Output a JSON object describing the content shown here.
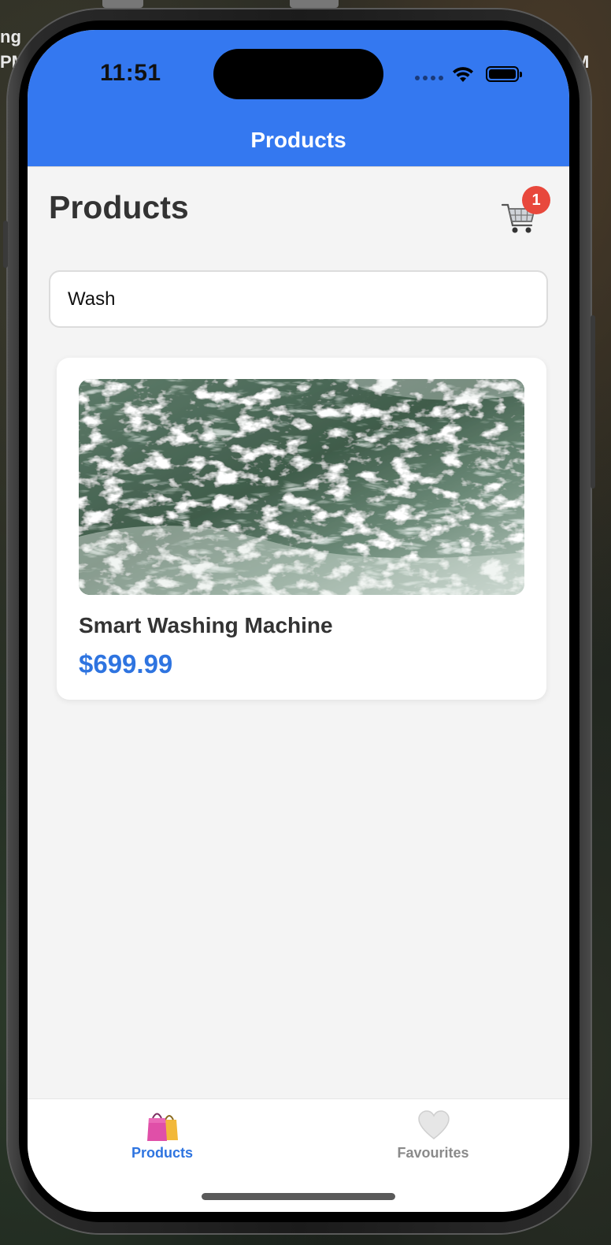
{
  "background": {
    "left_text_line1": "ng",
    "left_text_line2": "PM",
    "right_text": "M"
  },
  "status_bar": {
    "time": "11:51",
    "icons": [
      "cellular-dots-icon",
      "wifi-icon",
      "battery-icon"
    ]
  },
  "nav_bar": {
    "title": "Products",
    "background_color": "#3478f0"
  },
  "page": {
    "title": "Products",
    "cart": {
      "icon": "shopping-cart-icon",
      "badge_count": "1",
      "badge_color": "#e8483c"
    },
    "search": {
      "value": "Wash"
    }
  },
  "products": [
    {
      "name": "Smart Washing Machine",
      "price": "$699.99",
      "image": "ocean-waves-photo"
    }
  ],
  "tab_bar": {
    "tabs": [
      {
        "label": "Products",
        "icon": "shopping-bags-icon",
        "active": true
      },
      {
        "label": "Favourites",
        "icon": "heart-icon",
        "active": false
      }
    ],
    "active_color": "#2e74e0",
    "inactive_color": "#8a8a8a"
  }
}
